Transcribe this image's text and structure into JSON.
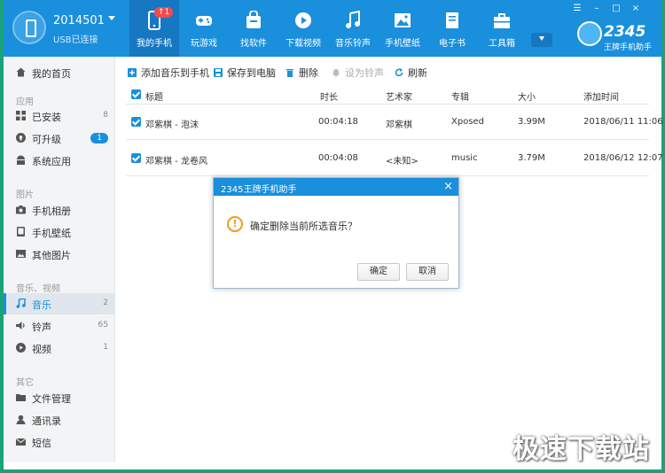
{
  "account": {
    "name": "2014501",
    "status": "USB已连接"
  },
  "nav": [
    {
      "label": "我的手机",
      "icon": "phone-icon",
      "active": true,
      "badge": "↑1"
    },
    {
      "label": "玩游戏",
      "icon": "gamepad-icon"
    },
    {
      "label": "找软件",
      "icon": "shopping-bag-icon"
    },
    {
      "label": "下载视频",
      "icon": "play-icon"
    },
    {
      "label": "音乐铃声",
      "icon": "music-note-icon"
    },
    {
      "label": "手机壁纸",
      "icon": "picture-icon"
    },
    {
      "label": "电子书",
      "icon": "book-icon"
    },
    {
      "label": "工具箱",
      "icon": "toolbox-icon"
    }
  ],
  "brand": {
    "number": "2345",
    "subtitle": "王牌手机助手"
  },
  "window_controls": {
    "skin": "☰",
    "minimize": "–",
    "maximize": "□",
    "close": "×"
  },
  "sidebar": {
    "home": "我的首页",
    "sections": {
      "apps": "应用",
      "pictures": "图片",
      "media": "音乐、视频",
      "other": "其它"
    },
    "items": {
      "installed": {
        "label": "已安装",
        "count": "8"
      },
      "upgradable": {
        "label": "可升级",
        "count": "1"
      },
      "system_apps": {
        "label": "系统应用"
      },
      "photos": {
        "label": "手机相册"
      },
      "wallpapers": {
        "label": "手机壁纸"
      },
      "other_pics": {
        "label": "其他图片"
      },
      "music": {
        "label": "音乐",
        "count": "2"
      },
      "ringtones": {
        "label": "铃声",
        "count": "65"
      },
      "videos": {
        "label": "视频",
        "count": "1"
      },
      "files": {
        "label": "文件管理"
      },
      "contacts": {
        "label": "通讯录"
      },
      "sms": {
        "label": "短信"
      }
    }
  },
  "toolbar": {
    "add": "添加音乐到手机",
    "save": "保存到电脑",
    "delete": "删除",
    "set_ringtone": "设为铃声",
    "refresh": "刷新"
  },
  "table": {
    "headers": {
      "title": "标题",
      "duration": "时长",
      "artist": "艺术家",
      "album": "专辑",
      "size": "大小",
      "added": "添加时间"
    },
    "rows": [
      {
        "title": "邓紫棋 - 泡沫",
        "duration": "00:04:18",
        "artist": "邓紫棋",
        "album": "Xposed",
        "size": "3.99M",
        "added": "2018/06/11 11:06"
      },
      {
        "title": "邓紫棋 - 龙卷风",
        "duration": "00:04:08",
        "artist": "<未知>",
        "album": "music",
        "size": "3.79M",
        "added": "2018/06/12 12:07"
      }
    ]
  },
  "dialog": {
    "title": "2345王牌手机助手",
    "close": "×",
    "icon": "!",
    "message": "确定删除当前所选音乐？",
    "ok": "确定",
    "cancel": "取消"
  },
  "watermark": "极速下载站",
  "colors": {
    "accent": "#1a8fdc",
    "warning": "#f29b1c",
    "badge": "#f24b4b",
    "frame": "#1aa27a"
  }
}
